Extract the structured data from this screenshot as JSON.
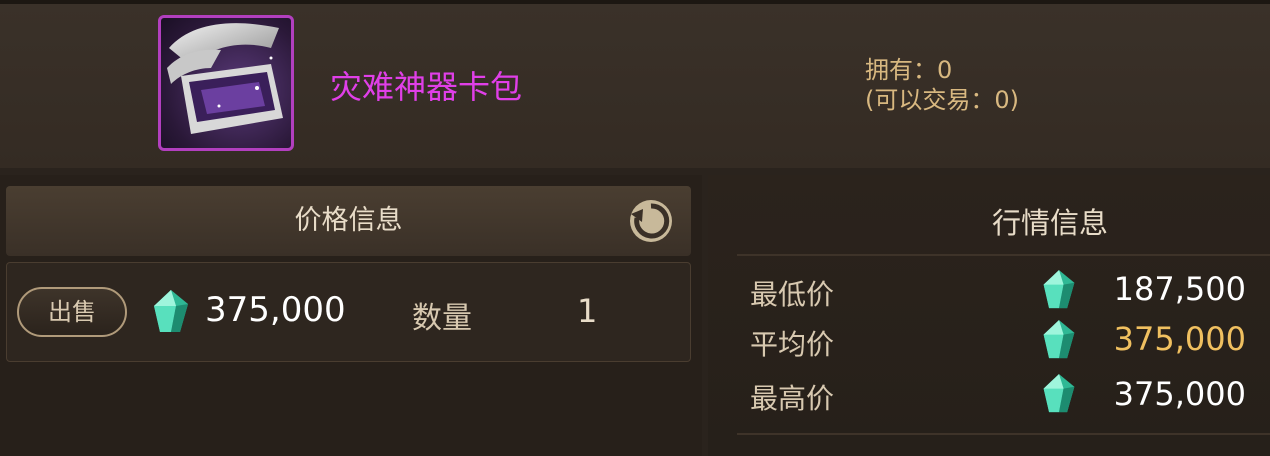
{
  "item": {
    "name": "灾难神器卡包",
    "owned_label": "拥有：0",
    "tradable_label": "(可以交易：0)"
  },
  "price_panel": {
    "title": "价格信息",
    "sell_button": "出售",
    "price": "375,000",
    "quantity_label": "数量",
    "quantity_value": "1"
  },
  "market_panel": {
    "title": "行情信息",
    "rows": [
      {
        "label": "最低价",
        "value": "187,500"
      },
      {
        "label": "平均价",
        "value": "375,000"
      },
      {
        "label": "最高价",
        "value": "375,000"
      }
    ]
  },
  "colors": {
    "item_name": "#e03fe8",
    "owned_text": "#d8b880",
    "average_value": "#f0c060",
    "gem": "#3fd8b0"
  },
  "icons": [
    "card-pack-icon",
    "refresh-icon",
    "gem-currency-icon"
  ]
}
